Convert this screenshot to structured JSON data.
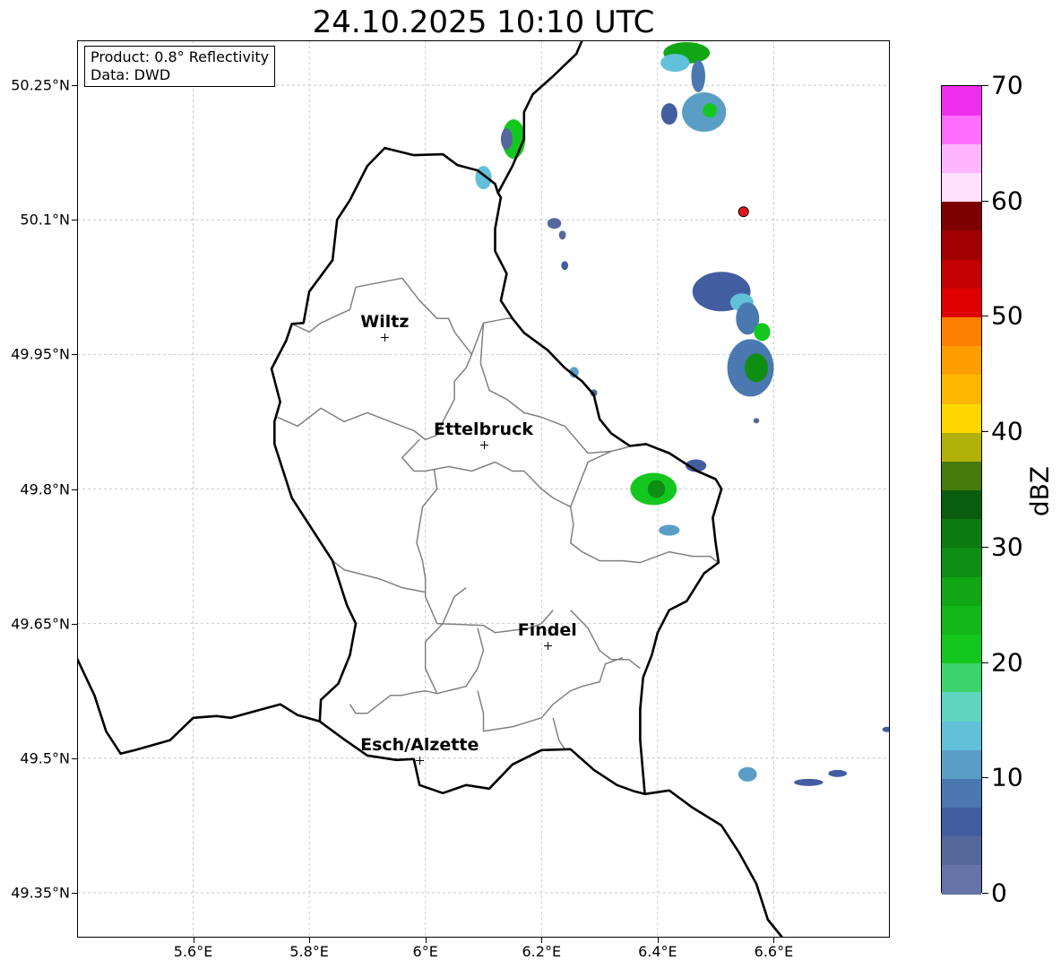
{
  "title": "24.10.2025 10:10 UTC",
  "info": {
    "product_line": "Product: 0.8° Reflectivity",
    "data_line": "Data: DWD"
  },
  "axes": {
    "lon_range": [
      5.4,
      6.8
    ],
    "lat_range": [
      49.3,
      50.3
    ],
    "lon_ticks": [
      {
        "value": 5.6,
        "label": "5.6°E"
      },
      {
        "value": 5.8,
        "label": "5.8°E"
      },
      {
        "value": 6.0,
        "label": "6°E"
      },
      {
        "value": 6.2,
        "label": "6.2°E"
      },
      {
        "value": 6.4,
        "label": "6.4°E"
      },
      {
        "value": 6.6,
        "label": "6.6°E"
      }
    ],
    "lat_ticks": [
      {
        "value": 50.25,
        "label": "50.25°N"
      },
      {
        "value": 50.1,
        "label": "50.1°N"
      },
      {
        "value": 49.95,
        "label": "49.95°N"
      },
      {
        "value": 49.8,
        "label": "49.8°N"
      },
      {
        "value": 49.65,
        "label": "49.65°N"
      },
      {
        "value": 49.5,
        "label": "49.5°N"
      },
      {
        "value": 49.35,
        "label": "49.35°N"
      }
    ]
  },
  "cities": [
    {
      "name": "Wiltz",
      "lon": 5.93,
      "lat": 49.969
    },
    {
      "name": "Ettelbruck",
      "lon": 6.1,
      "lat": 49.849
    },
    {
      "name": "Findel",
      "lon": 6.21,
      "lat": 49.626
    },
    {
      "name": "Esch/Alzette",
      "lon": 5.99,
      "lat": 49.498
    }
  ],
  "radar_site": {
    "lon": 6.548,
    "lat": 50.109,
    "color": "#e8141c"
  },
  "colorbar": {
    "label": "dBZ",
    "min": 0,
    "max": 70,
    "step": 2.5,
    "tick_values": [
      0,
      10,
      20,
      30,
      40,
      50,
      60,
      70
    ],
    "tick_labels": [
      "0",
      "10",
      "20",
      "30",
      "40",
      "50",
      "60",
      "70"
    ],
    "colors": [
      "#6473a8",
      "#55689c",
      "#435ea0",
      "#4a78b0",
      "#5a9ec6",
      "#62c0da",
      "#5fd6c2",
      "#3cd46a",
      "#14c71e",
      "#12b81a",
      "#10a614",
      "#0e8e12",
      "#0b7a10",
      "#0a5c0e",
      "#477a0c",
      "#b1b10a",
      "#ffd700",
      "#ffb800",
      "#ff9e00",
      "#ff8000",
      "#e00000",
      "#c40000",
      "#a00000",
      "#7c0000",
      "#ffe0ff",
      "#ffb4ff",
      "#ff6eff",
      "#ee30ee"
    ]
  },
  "echoes": [
    {
      "lon": 6.45,
      "lat": 50.286,
      "rlon": 0.04,
      "rlat": 0.012,
      "dbz": 27
    },
    {
      "lon": 6.43,
      "lat": 50.275,
      "rlon": 0.025,
      "rlat": 0.01,
      "dbz": 14
    },
    {
      "lon": 6.48,
      "lat": 50.22,
      "rlon": 0.038,
      "rlat": 0.022,
      "dbz": 10
    },
    {
      "lon": 6.49,
      "lat": 50.222,
      "rlon": 0.012,
      "rlat": 0.008,
      "dbz": 22
    },
    {
      "lon": 6.42,
      "lat": 50.218,
      "rlon": 0.014,
      "rlat": 0.012,
      "dbz": 6
    },
    {
      "lon": 6.47,
      "lat": 50.26,
      "rlon": 0.012,
      "rlat": 0.018,
      "dbz": 8
    },
    {
      "lon": 6.152,
      "lat": 50.19,
      "rlon": 0.02,
      "rlat": 0.022,
      "dbz": 20
    },
    {
      "lon": 6.14,
      "lat": 50.19,
      "rlon": 0.01,
      "rlat": 0.012,
      "dbz": 4
    },
    {
      "lon": 6.1,
      "lat": 50.147,
      "rlon": 0.014,
      "rlat": 0.013,
      "dbz": 14
    },
    {
      "lon": 6.222,
      "lat": 50.096,
      "rlon": 0.012,
      "rlat": 0.006,
      "dbz": 4
    },
    {
      "lon": 6.236,
      "lat": 50.083,
      "rlon": 0.006,
      "rlat": 0.005,
      "dbz": 4
    },
    {
      "lon": 6.24,
      "lat": 50.049,
      "rlon": 0.006,
      "rlat": 0.005,
      "dbz": 6
    },
    {
      "lon": 6.51,
      "lat": 50.02,
      "rlon": 0.05,
      "rlat": 0.022,
      "dbz": 6
    },
    {
      "lon": 6.545,
      "lat": 50.008,
      "rlon": 0.02,
      "rlat": 0.01,
      "dbz": 14
    },
    {
      "lon": 6.555,
      "lat": 49.99,
      "rlon": 0.02,
      "rlat": 0.018,
      "dbz": 8
    },
    {
      "lon": 6.58,
      "lat": 49.975,
      "rlon": 0.014,
      "rlat": 0.01,
      "dbz": 22
    },
    {
      "lon": 6.56,
      "lat": 49.935,
      "rlon": 0.04,
      "rlat": 0.032,
      "dbz": 8
    },
    {
      "lon": 6.57,
      "lat": 49.935,
      "rlon": 0.02,
      "rlat": 0.016,
      "dbz": 29
    },
    {
      "lon": 6.57,
      "lat": 49.876,
      "rlon": 0.005,
      "rlat": 0.003,
      "dbz": 4
    },
    {
      "lon": 6.256,
      "lat": 49.93,
      "rlon": 0.008,
      "rlat": 0.006,
      "dbz": 10
    },
    {
      "lon": 6.29,
      "lat": 49.907,
      "rlon": 0.006,
      "rlat": 0.004,
      "dbz": 4
    },
    {
      "lon": 6.393,
      "lat": 49.8,
      "rlon": 0.04,
      "rlat": 0.018,
      "dbz": 20
    },
    {
      "lon": 6.398,
      "lat": 49.8,
      "rlon": 0.015,
      "rlat": 0.01,
      "dbz": 28
    },
    {
      "lon": 6.466,
      "lat": 49.826,
      "rlon": 0.018,
      "rlat": 0.007,
      "dbz": 6
    },
    {
      "lon": 6.42,
      "lat": 49.754,
      "rlon": 0.018,
      "rlat": 0.006,
      "dbz": 12
    },
    {
      "lon": 6.555,
      "lat": 49.482,
      "rlon": 0.016,
      "rlat": 0.008,
      "dbz": 10
    },
    {
      "lon": 6.66,
      "lat": 49.473,
      "rlon": 0.025,
      "rlat": 0.004,
      "dbz": 6
    },
    {
      "lon": 6.71,
      "lat": 49.483,
      "rlon": 0.016,
      "rlat": 0.004,
      "dbz": 6
    },
    {
      "lon": 6.795,
      "lat": 49.532,
      "rlon": 0.008,
      "rlat": 0.003,
      "dbz": 6
    }
  ],
  "country_border": [
    [
      5.4,
      49.611
    ],
    [
      5.43,
      49.57
    ],
    [
      5.45,
      49.53
    ],
    [
      5.475,
      49.505
    ],
    [
      5.5,
      49.509
    ],
    [
      5.56,
      49.52
    ],
    [
      5.6,
      49.545
    ],
    [
      5.64,
      49.547
    ],
    [
      5.665,
      49.545
    ],
    [
      5.71,
      49.553
    ],
    [
      5.75,
      49.56
    ],
    [
      5.78,
      49.548
    ],
    [
      5.818,
      49.541
    ],
    [
      5.86,
      49.521
    ],
    [
      5.9,
      49.503
    ],
    [
      5.95,
      49.498
    ],
    [
      5.98,
      49.499
    ],
    [
      5.99,
      49.47
    ],
    [
      6.03,
      49.461
    ],
    [
      6.07,
      49.47
    ],
    [
      6.11,
      49.466
    ],
    [
      6.15,
      49.493
    ],
    [
      6.2,
      49.509
    ],
    [
      6.25,
      49.51
    ],
    [
      6.29,
      49.487
    ],
    [
      6.33,
      49.47
    ],
    [
      6.36,
      49.463
    ],
    [
      6.378,
      49.46
    ],
    [
      6.42,
      49.464
    ],
    [
      6.46,
      49.445
    ],
    [
      6.51,
      49.425
    ],
    [
      6.54,
      49.395
    ],
    [
      6.57,
      49.36
    ],
    [
      6.59,
      49.32
    ],
    [
      6.615,
      49.3
    ],
    [
      6.62,
      49.285
    ]
  ],
  "lux_border": [
    [
      5.818,
      49.541
    ],
    [
      5.82,
      49.565
    ],
    [
      5.85,
      49.583
    ],
    [
      5.87,
      49.615
    ],
    [
      5.88,
      49.65
    ],
    [
      5.865,
      49.67
    ],
    [
      5.84,
      49.72
    ],
    [
      5.8,
      49.76
    ],
    [
      5.77,
      49.79
    ],
    [
      5.74,
      49.85
    ],
    [
      5.74,
      49.875
    ],
    [
      5.75,
      49.897
    ],
    [
      5.735,
      49.934
    ],
    [
      5.76,
      49.965
    ],
    [
      5.77,
      49.984
    ],
    [
      5.79,
      49.985
    ],
    [
      5.8,
      50.02
    ],
    [
      5.84,
      50.055
    ],
    [
      5.848,
      50.1
    ],
    [
      5.87,
      50.122
    ],
    [
      5.9,
      50.16
    ],
    [
      5.93,
      50.18
    ],
    [
      5.98,
      50.172
    ],
    [
      6.03,
      50.173
    ],
    [
      6.055,
      50.161
    ],
    [
      6.09,
      50.155
    ],
    [
      6.12,
      50.14
    ],
    [
      6.125,
      50.13
    ],
    [
      6.13,
      50.125
    ],
    [
      6.12,
      50.09
    ],
    [
      6.12,
      50.065
    ],
    [
      6.14,
      50.04
    ],
    [
      6.13,
      50.01
    ],
    [
      6.15,
      49.99
    ],
    [
      6.17,
      49.974
    ],
    [
      6.21,
      49.955
    ],
    [
      6.24,
      49.935
    ],
    [
      6.27,
      49.92
    ],
    [
      6.29,
      49.905
    ],
    [
      6.3,
      49.878
    ],
    [
      6.32,
      49.862
    ],
    [
      6.352,
      49.848
    ],
    [
      6.38,
      49.85
    ],
    [
      6.42,
      49.84
    ],
    [
      6.468,
      49.82
    ],
    [
      6.5,
      49.811
    ],
    [
      6.51,
      49.8
    ],
    [
      6.495,
      49.768
    ],
    [
      6.5,
      49.74
    ],
    [
      6.505,
      49.718
    ],
    [
      6.48,
      49.706
    ],
    [
      6.45,
      49.675
    ],
    [
      6.42,
      49.665
    ],
    [
      6.4,
      49.64
    ],
    [
      6.39,
      49.615
    ],
    [
      6.375,
      49.59
    ],
    [
      6.37,
      49.555
    ],
    [
      6.37,
      49.52
    ],
    [
      6.378,
      49.46
    ]
  ],
  "de_be_border": [
    [
      6.125,
      50.13
    ],
    [
      6.15,
      50.16
    ],
    [
      6.17,
      50.19
    ],
    [
      6.17,
      50.22
    ],
    [
      6.185,
      50.24
    ],
    [
      6.22,
      50.26
    ],
    [
      6.26,
      50.285
    ],
    [
      6.27,
      50.3
    ]
  ],
  "cantons": [
    [
      [
        5.77,
        49.984
      ],
      [
        5.8,
        49.975
      ],
      [
        5.82,
        49.985
      ],
      [
        5.87,
        50.0
      ],
      [
        5.88,
        50.025
      ],
      [
        5.92,
        50.03
      ],
      [
        5.96,
        50.035
      ],
      [
        5.99,
        50.01
      ],
      [
        6.02,
        49.99
      ],
      [
        6.04,
        49.99
      ],
      [
        6.05,
        49.975
      ],
      [
        6.08,
        49.95
      ],
      [
        6.1,
        49.985
      ],
      [
        6.14,
        49.99
      ],
      [
        6.15,
        49.99
      ]
    ],
    [
      [
        5.745,
        49.88
      ],
      [
        5.78,
        49.87
      ],
      [
        5.82,
        49.89
      ],
      [
        5.86,
        49.875
      ],
      [
        5.9,
        49.885
      ],
      [
        5.94,
        49.875
      ],
      [
        5.98,
        49.865
      ],
      [
        6.0,
        49.855
      ],
      [
        6.02,
        49.86
      ],
      [
        6.03,
        49.875
      ],
      [
        6.05,
        49.9
      ],
      [
        6.05,
        49.92
      ],
      [
        6.07,
        49.935
      ],
      [
        6.08,
        49.95
      ]
    ],
    [
      [
        6.1,
        49.985
      ],
      [
        6.095,
        49.94
      ],
      [
        6.11,
        49.91
      ],
      [
        6.14,
        49.9
      ],
      [
        6.17,
        49.885
      ],
      [
        6.2,
        49.88
      ],
      [
        6.24,
        49.87
      ],
      [
        6.28,
        49.84
      ],
      [
        6.32,
        49.842
      ]
    ],
    [
      [
        5.99,
        49.855
      ],
      [
        5.96,
        49.835
      ],
      [
        5.98,
        49.82
      ],
      [
        6.0,
        49.82
      ],
      [
        6.04,
        49.825
      ],
      [
        6.08,
        49.82
      ],
      [
        6.12,
        49.83
      ],
      [
        6.15,
        49.82
      ],
      [
        6.17,
        49.82
      ],
      [
        6.2,
        49.8
      ],
      [
        6.22,
        49.79
      ],
      [
        6.25,
        49.78
      ],
      [
        6.28,
        49.83
      ],
      [
        6.32,
        49.842
      ],
      [
        6.35,
        49.847
      ]
    ],
    [
      [
        6.015,
        49.822
      ],
      [
        6.02,
        49.8
      ],
      [
        5.995,
        49.78
      ],
      [
        5.99,
        49.76
      ],
      [
        5.985,
        49.74
      ],
      [
        5.995,
        49.72
      ],
      [
        6.0,
        49.7
      ],
      [
        6.0,
        49.68
      ],
      [
        6.02,
        49.65
      ],
      [
        6.1,
        49.648
      ],
      [
        6.12,
        49.64
      ],
      [
        6.18,
        49.645
      ],
      [
        6.2,
        49.65
      ],
      [
        6.22,
        49.665
      ]
    ],
    [
      [
        6.25,
        49.78
      ],
      [
        6.255,
        49.76
      ],
      [
        6.25,
        49.74
      ],
      [
        6.27,
        49.73
      ],
      [
        6.3,
        49.72
      ],
      [
        6.34,
        49.72
      ],
      [
        6.37,
        49.718
      ],
      [
        6.42,
        49.73
      ],
      [
        6.46,
        49.725
      ],
      [
        6.49,
        49.725
      ],
      [
        6.505,
        49.718
      ]
    ],
    [
      [
        5.84,
        49.72
      ],
      [
        5.86,
        49.71
      ],
      [
        5.92,
        49.7
      ],
      [
        5.96,
        49.69
      ],
      [
        6.0,
        49.685
      ]
    ],
    [
      [
        6.09,
        49.645
      ],
      [
        6.1,
        49.62
      ],
      [
        6.09,
        49.6
      ],
      [
        6.07,
        49.58
      ],
      [
        6.02,
        49.572
      ],
      [
        6.0,
        49.575
      ],
      [
        5.98,
        49.573
      ],
      [
        5.96,
        49.57
      ],
      [
        5.94,
        49.57
      ],
      [
        5.92,
        49.56
      ],
      [
        5.9,
        49.55
      ],
      [
        5.88,
        49.55
      ],
      [
        5.87,
        49.56
      ]
    ],
    [
      [
        6.02,
        49.572
      ],
      [
        6.0,
        49.6
      ],
      [
        6.0,
        49.63
      ],
      [
        6.03,
        49.65
      ],
      [
        6.05,
        49.68
      ],
      [
        6.07,
        49.69
      ]
    ],
    [
      [
        6.25,
        49.665
      ],
      [
        6.28,
        49.645
      ],
      [
        6.3,
        49.62
      ],
      [
        6.32,
        49.61
      ],
      [
        6.35,
        49.61
      ],
      [
        6.37,
        49.6
      ]
    ],
    [
      [
        6.09,
        49.575
      ],
      [
        6.1,
        49.55
      ],
      [
        6.1,
        49.53
      ],
      [
        6.15,
        49.535
      ],
      [
        6.2,
        49.545
      ],
      [
        6.22,
        49.56
      ],
      [
        6.25,
        49.575
      ],
      [
        6.27,
        49.58
      ],
      [
        6.3,
        49.585
      ],
      [
        6.31,
        49.605
      ],
      [
        6.34,
        49.612
      ]
    ],
    [
      [
        6.22,
        49.545
      ],
      [
        6.23,
        49.52
      ],
      [
        6.24,
        49.51
      ]
    ]
  ]
}
